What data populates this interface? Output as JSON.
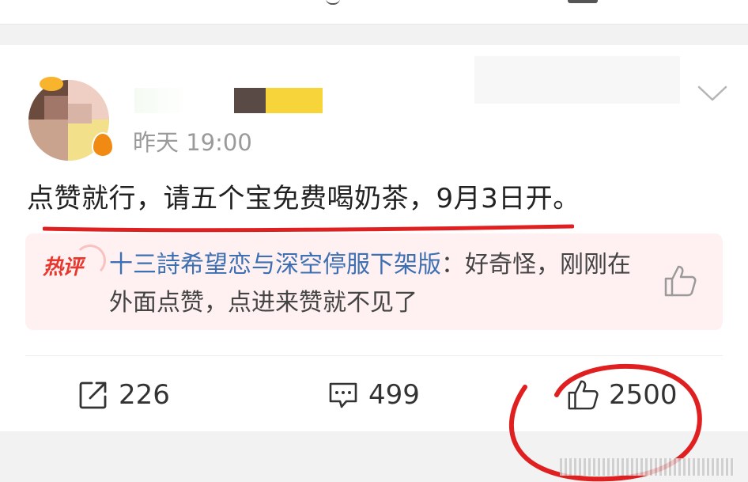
{
  "post": {
    "timestamp": "昨天 19:00",
    "text": "点赞就行，请五个宝免费喝奶茶，9月3日开。"
  },
  "hot_comment": {
    "tag": "热评",
    "user": "十三詩希望恋与深空停服下架版",
    "separator": "：",
    "text": "好奇怪，刚刚在外面点赞，点进来赞就不见了"
  },
  "actions": {
    "repost_count": "226",
    "comment_count": "499",
    "like_count": "2500"
  },
  "colors": {
    "accent_red": "#e7362d",
    "username_blue": "#3d6fb3",
    "annotation_red": "#e02020"
  },
  "icons": {
    "more": "chevron-down-icon",
    "repost": "share-icon",
    "comment": "comment-icon",
    "like": "thumbs-up-icon"
  }
}
